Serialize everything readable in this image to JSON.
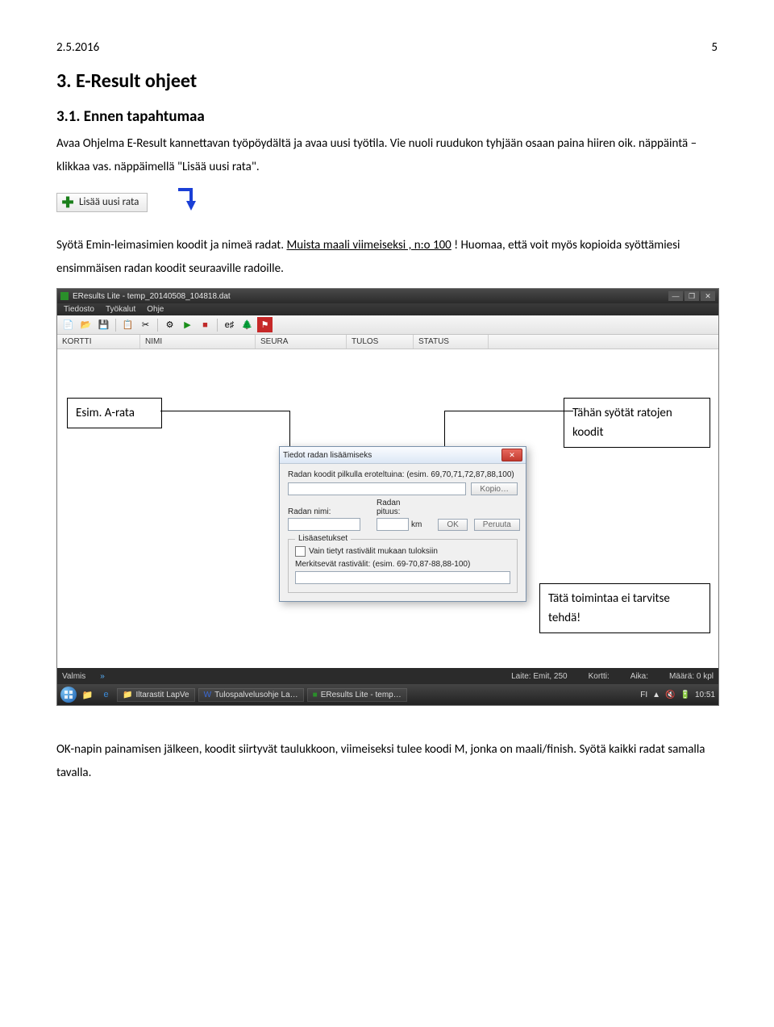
{
  "header": {
    "date": "2.5.2016",
    "page": "5"
  },
  "section_title": "3. E-Result ohjeet",
  "subsection_title": "3.1. Ennen tapahtumaa",
  "para1_a": "Avaa Ohjelma E-Result kannettavan työpöydältä ja avaa uusi työtila. Vie nuoli ruudukon tyhjään osaan paina hiiren oik. näppäintä – klikkaa vas. näppäimellä \"Lisää uusi rata\".",
  "add_button_label": "Lisää uusi rata",
  "para2_a": "Syötä Emin-leimasimien koodit ja nimeä radat. ",
  "para2_u": "Muista maali viimeiseksi , n:o 100",
  "para2_b": " ! Huomaa, että voit myös kopioida syöttämiesi ensimmäisen radan koodit seuraaville radoille.",
  "annot1": "Esim. A-rata",
  "annot2": "Tähän syötät ratojen koodit",
  "annot3": "Tätä toimintaa ei tarvitse tehdä!",
  "app": {
    "title": "EResults Lite - temp_20140508_104818.dat",
    "menu": [
      "Tiedosto",
      "Työkalut",
      "Ohje"
    ],
    "columns": [
      "KORTTI",
      "NIMI",
      "SEURA",
      "TULOS",
      "STATUS"
    ],
    "status_left": "Valmis",
    "status_emit": "Laite: Emit, 250",
    "status_kortti": "Kortti:",
    "status_aika": "Aika:",
    "status_maara": "Määrä: 0 kpl"
  },
  "taskbar": {
    "items": [
      "Iltarastit LapVe",
      "Tulospalvelusohje La…",
      "EResults Lite - temp…"
    ],
    "lang": "FI",
    "clock": "10:51"
  },
  "dialog": {
    "title": "Tiedot radan lisäämiseks",
    "label_codes": "Radan koodit pilkulla eroteltuina: (esim. 69,70,71,72,87,88,100)",
    "btn_copy": "Kopio…",
    "label_name": "Radan nimi:",
    "label_length": "Radan pituus:",
    "unit_km": "km",
    "btn_ok": "OK",
    "btn_cancel": "Peruuta",
    "fieldset": "Lisäasetukset",
    "chk_label": "Vain tietyt rastivälit mukaan tuloksiin",
    "label_merk": "Merkitsevät rastivälit: (esim. 69-70,87-88,88-100)"
  },
  "footer_para": "OK-napin painamisen jälkeen, koodit siirtyvät taulukkoon, viimeiseksi tulee koodi M, jonka on maali/finish.  Syötä kaikki radat samalla tavalla."
}
